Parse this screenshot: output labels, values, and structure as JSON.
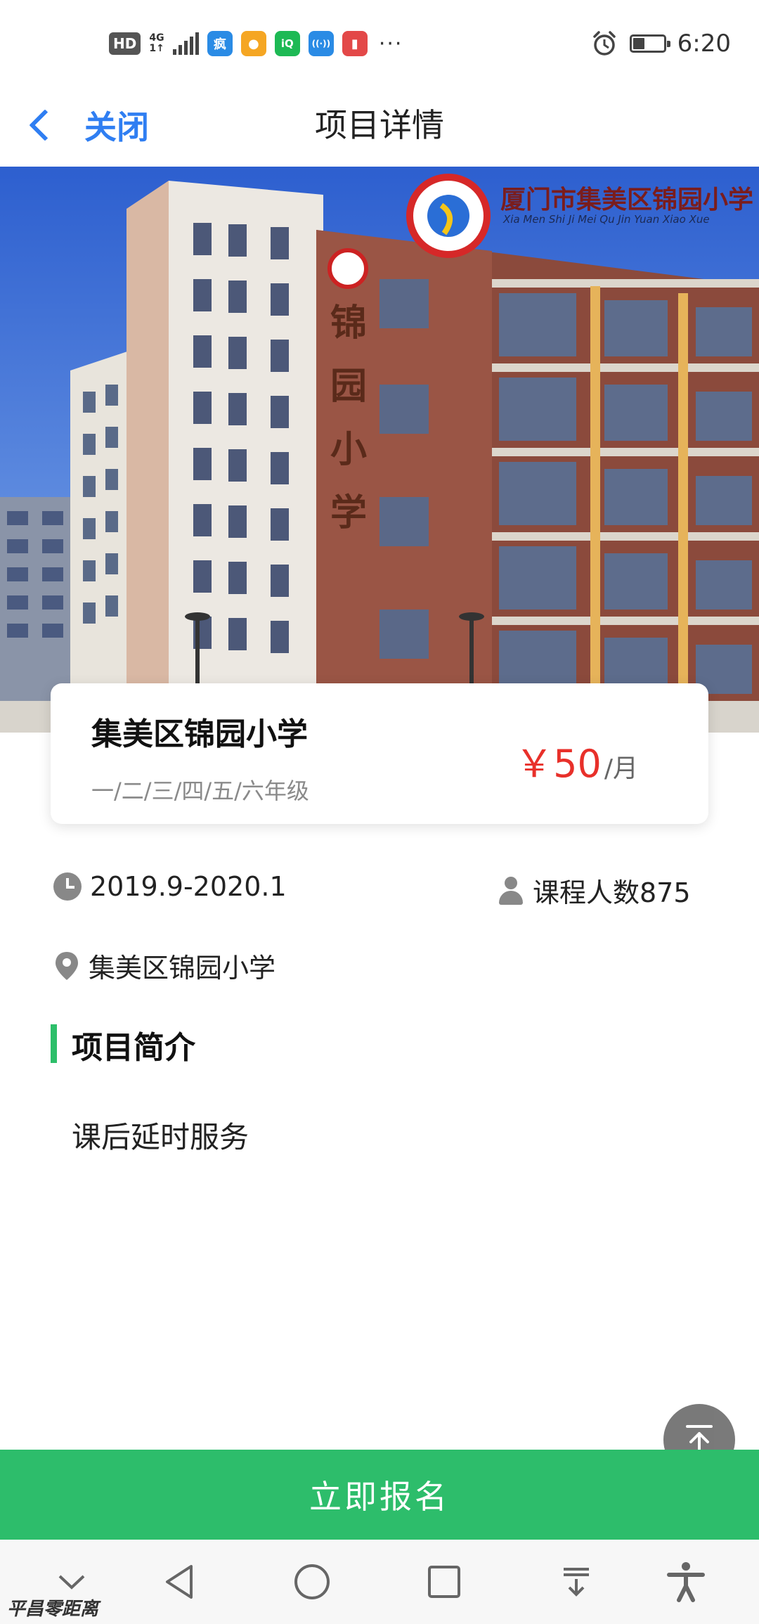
{
  "status_bar": {
    "hd_badge": "HD",
    "network_type": "4G",
    "network_sub": "1↑",
    "app_icons": [
      {
        "name": "map-app-icon",
        "color": "#2a8be5",
        "glyph": "疯"
      },
      {
        "name": "location-app-icon",
        "color": "#f5a623",
        "glyph": "●"
      },
      {
        "name": "iqiyi-app-icon",
        "color": "#1db954",
        "glyph": "iQ"
      },
      {
        "name": "wifi-app-icon",
        "color": "#2a8be5",
        "glyph": "((·))"
      },
      {
        "name": "book-app-icon",
        "color": "#e34848",
        "glyph": "▮"
      }
    ],
    "more_dots": "···",
    "time": "6:20"
  },
  "header": {
    "back_label": "关闭",
    "title": "项目详情"
  },
  "hero": {
    "school_logo_text": "厦门市集美区锦园小学",
    "school_logo_sub": "Xia Men Shi Ji Mei Qu Jin Yuan Xiao Xue",
    "building_sign": "锦园小学"
  },
  "card": {
    "title": "集美区锦园小学",
    "grades": "一/二/三/四/五/六年级",
    "price": "￥50",
    "price_unit": "/月"
  },
  "info": {
    "date_range": "2019.9-2020.1",
    "enrollment": "课程人数875",
    "location": "集美区锦园小学"
  },
  "section": {
    "title": "项目简介",
    "intro": "课后延时服务"
  },
  "signup_label": "立即报名",
  "watermark": "平昌零距离",
  "colors": {
    "accent_blue": "#2f7ef2",
    "accent_green": "#2dbd6b",
    "price_red": "#e8302a"
  }
}
